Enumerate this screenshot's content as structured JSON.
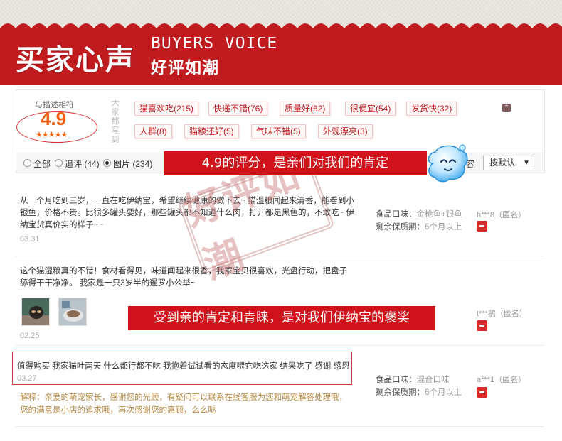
{
  "header": {
    "title": "买家心声",
    "title_en": "BUYERS VOICE",
    "subtitle": "好评如潮"
  },
  "rating": {
    "label": "与描述相符",
    "score": "4.9",
    "stars": "★★★★★",
    "vertical_label": "大家都写到"
  },
  "tags": [
    {
      "label": "猫喜欢吃(215)"
    },
    {
      "label": "快递不错(76)"
    },
    {
      "label": "质量好(62)"
    },
    {
      "label": "很便宜(54)"
    },
    {
      "label": "发货快(32)"
    },
    {
      "label": "人群(8)"
    },
    {
      "label": "猫粮还好(5)"
    },
    {
      "label": "气味不错(5)"
    },
    {
      "label": "外观漂亮(3)"
    }
  ],
  "filter": {
    "all": "全部",
    "followup": "追评 (44)",
    "images": "图片 (234)",
    "content": "容",
    "sort": "按默认"
  },
  "callouts": {
    "first": "4.9的评分，是亲们对我们的肯定",
    "second": "受到亲的肯定和青睐，是对我们伊纳宝的褒奖"
  },
  "stamp": "好评如潮",
  "reviews": [
    {
      "text": "从一个月吃到三岁，一直在吃伊纳宝，希望继续健康的做下去~ 猫湿粮闻起来清香，能看到小银鱼，价格不贵。比很多罐头要好，那些罐头都不知道什么肉，打开都是黑色的，不敢吃~ 伊纳宝货真价实的样子~~",
      "date": "03.31",
      "flavor_label": "食品口味：",
      "flavor": "金枪鱼+银鱼",
      "shelf_label": "剩余保质期：",
      "shelf": "6个月以上",
      "user": "h***8（匿名）"
    },
    {
      "text": "这个猫湿粮真的不错！食材看得见，味道闻起来很香，我家宝贝很喜欢，光盘行动，把盘子舔得干干净净。 我家是一只3岁半的暹罗小公举~",
      "date": "02.25",
      "user": "t***鹅（匿名）"
    },
    {
      "text": "值得购买 我家猫吐两天 什么都行都不吃 我抱着试试看的态度喂它吃这家 结果吃了 感谢 感恩",
      "date": "03.27",
      "flavor_label": "食品口味：",
      "flavor": "混合口味",
      "shelf_label": "剩余保质期：",
      "shelf": "6个月以上",
      "user": "a***1（匿名）",
      "reply": "解释：亲爱的萌宠家长，感谢您的光顾，有疑问可以联系在线客服为您和萌宠解答处理哦，您的满意是小店的追求哦，再次感谢您的惠顾，么么哒"
    }
  ],
  "colors": {
    "brand_red": "#c01c20",
    "callout_red": "#d0131a",
    "score_orange": "#f06010",
    "reply_gold": "#b58a44"
  }
}
